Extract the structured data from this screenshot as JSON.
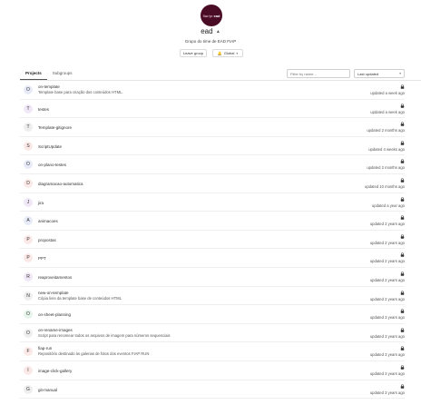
{
  "group": {
    "logo_text_light": "fiar/pr",
    "logo_text_bold": "ead",
    "name": "ead",
    "description": "Grupo do time de EAD FIAP",
    "leave_label": "Leave group",
    "notification_label": "Global"
  },
  "tabs": [
    {
      "label": "Projects",
      "active": true
    },
    {
      "label": "Subgroups",
      "active": false
    }
  ],
  "filter": {
    "placeholder": "Filter by name..."
  },
  "sort": {
    "label": "Last updated"
  },
  "projects": [
    {
      "initial": "O",
      "color": "#e7ebf8",
      "name": "on-template",
      "description": "Template base para criação dos conteúdos HTML.",
      "updated": "updated a week ago"
    },
    {
      "initial": "T",
      "color": "#f0e8f6",
      "name": "testes",
      "description": "",
      "updated": "updated a week ago"
    },
    {
      "initial": "T",
      "color": "#eeeeee",
      "name": "Template-gitignore",
      "description": "",
      "updated": "updated 2 months ago"
    },
    {
      "initial": "S",
      "color": "#fbe9e7",
      "name": "ScriptUpdate",
      "description": "",
      "updated": "updated 4 weeks ago"
    },
    {
      "initial": "O",
      "color": "#e7ebf8",
      "name": "on-plano-testes",
      "description": "",
      "updated": "updated 2 months ago"
    },
    {
      "initial": "D",
      "color": "#fbe9e7",
      "name": "diagramacao-automatica",
      "description": "",
      "updated": "updated 10 months ago"
    },
    {
      "initial": "J",
      "color": "#f0e8f6",
      "name": "jira",
      "description": "",
      "updated": "updated a year ago"
    },
    {
      "initial": "A",
      "color": "#e7ebf8",
      "name": "animacoes",
      "description": "",
      "updated": "updated 2 years ago"
    },
    {
      "initial": "P",
      "color": "#fbe9e7",
      "name": "propostas",
      "description": "",
      "updated": "updated 2 years ago"
    },
    {
      "initial": "P",
      "color": "#fbe9e7",
      "name": "PPT",
      "description": "",
      "updated": "updated 2 years ago"
    },
    {
      "initial": "R",
      "color": "#f0e8f6",
      "name": "reaproveitamentos",
      "description": "",
      "updated": "updated 2 years ago"
    },
    {
      "initial": "N",
      "color": "#eeeeee",
      "name": "new-on-template",
      "description": "Cópia livre da template base de conteúdos HTML",
      "updated": "updated 2 years ago"
    },
    {
      "initial": "O",
      "color": "#e6f4ea",
      "name": "on-sheet-planning",
      "description": "",
      "updated": "updated 3 years ago"
    },
    {
      "initial": "O",
      "color": "#eeeeee",
      "name": "on-rename-images",
      "description": "Script para renomear todos os arquivos de imagem para números sequenciais",
      "updated": "updated 3 years ago"
    },
    {
      "initial": "F",
      "color": "#fbe9e7",
      "name": "fiap-run",
      "description": "Repositório destinado às galerias de fotos dos eventos FIAP RUN",
      "updated": "updated 3 years ago"
    },
    {
      "initial": "I",
      "color": "#fbe9e7",
      "name": "image-click-gallery",
      "description": "",
      "updated": "updated 3 years ago"
    },
    {
      "initial": "G",
      "color": "#eeeeee",
      "name": "git-manual",
      "description": "",
      "updated": "updated 3 years ago"
    }
  ]
}
